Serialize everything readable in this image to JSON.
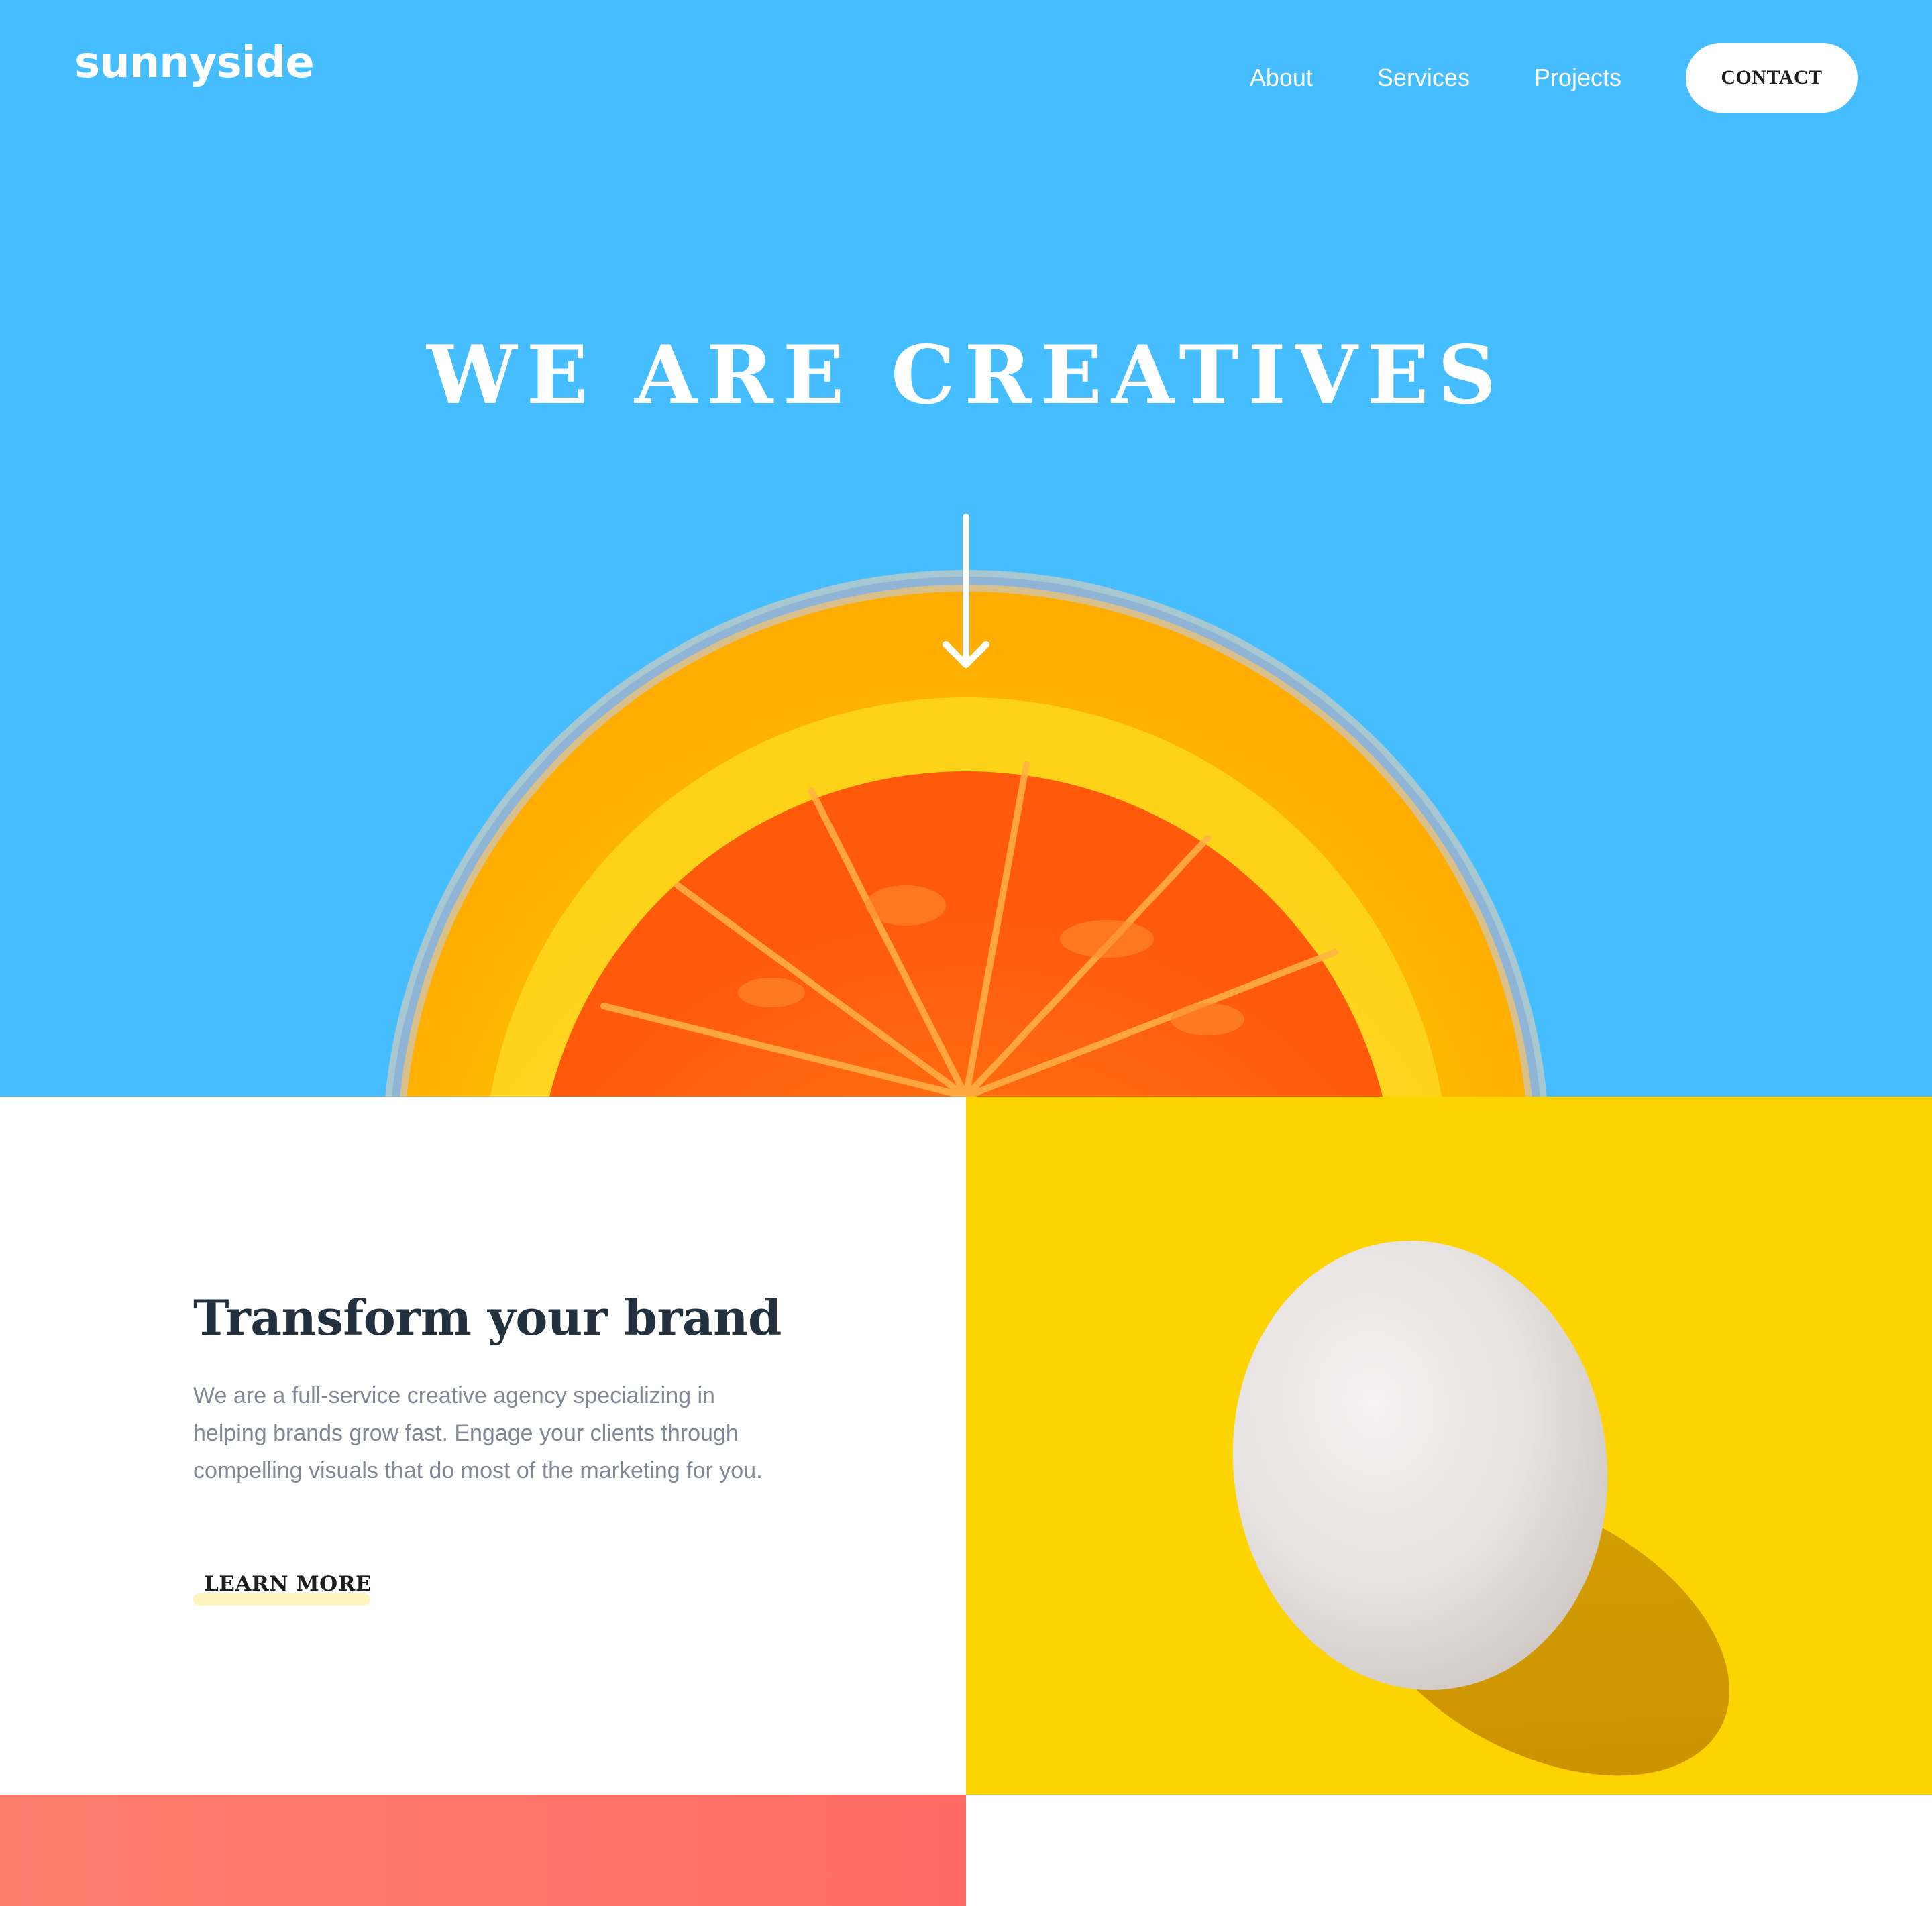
{
  "brand": {
    "logo_text": "sunnyside"
  },
  "nav": {
    "items": [
      {
        "label": "About"
      },
      {
        "label": "Services"
      },
      {
        "label": "Projects"
      }
    ],
    "contact_label": "CONTACT"
  },
  "hero": {
    "title": "WE ARE CREATIVES",
    "scroll_icon": "arrow-down-icon",
    "image_subject": "orange-slice-in-glass",
    "background_color": "#45bdfe"
  },
  "feature": {
    "title": "Transform your brand",
    "body": "We are a full-service creative agency specializing in helping brands grow fast. Engage your clients through compelling visuals that do most of the marketing for you.",
    "cta_label": "LEARN MORE",
    "cta_underline_color": "#fed400",
    "image_subject": "egg-on-yellow",
    "image_background_color": "#fed400"
  },
  "colors": {
    "title_dark": "#23303e",
    "body_grey": "#818797",
    "coral": "#ff7f6d"
  }
}
